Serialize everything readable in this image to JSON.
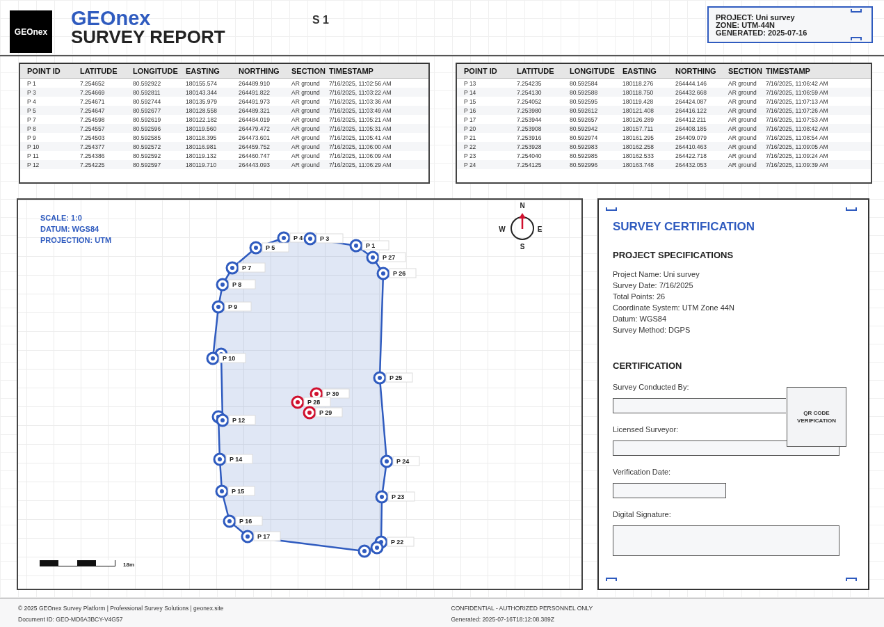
{
  "header": {
    "logo": "GEOnex",
    "brand": "GEOnex",
    "title": "SURVEY REPORT",
    "sheet": "S 1",
    "info": [
      "PROJECT: Uni survey",
      "ZONE: UTM-44N",
      "GENERATED: 2025-07-16"
    ]
  },
  "tables": [
    {
      "columns": [
        "POINT ID",
        "LATITUDE",
        "LONGITUDE",
        "EASTING",
        "NORTHING",
        "SECTION",
        "TIMESTAMP"
      ],
      "rows": [
        [
          "P 1",
          "7.254652",
          "80.592922",
          "180155.574",
          "264489.910",
          "AR ground",
          "7/16/2025, 11:02:56 AM"
        ],
        [
          "P 3",
          "7.254669",
          "80.592811",
          "180143.344",
          "264491.822",
          "AR ground",
          "7/16/2025, 11:03:22 AM"
        ],
        [
          "P 4",
          "7.254671",
          "80.592744",
          "180135.979",
          "264491.973",
          "AR ground",
          "7/16/2025, 11:03:36 AM"
        ],
        [
          "P 5",
          "7.254647",
          "80.592677",
          "180128.558",
          "264489.321",
          "AR ground",
          "7/16/2025, 11:03:49 AM"
        ],
        [
          "P 7",
          "7.254598",
          "80.592619",
          "180122.182",
          "264484.019",
          "AR ground",
          "7/16/2025, 11:05:21 AM"
        ],
        [
          "P 8",
          "7.254557",
          "80.592596",
          "180119.560",
          "264479.472",
          "AR ground",
          "7/16/2025, 11:05:31 AM"
        ],
        [
          "P 9",
          "7.254503",
          "80.592585",
          "180118.395",
          "264473.601",
          "AR ground",
          "7/16/2025, 11:05:41 AM"
        ],
        [
          "P 10",
          "7.254377",
          "80.592572",
          "180116.981",
          "264459.752",
          "AR ground",
          "7/16/2025, 11:06:00 AM"
        ],
        [
          "P 11",
          "7.254386",
          "80.592592",
          "180119.132",
          "264460.747",
          "AR ground",
          "7/16/2025, 11:06:09 AM"
        ],
        [
          "P 12",
          "7.254225",
          "80.592597",
          "180119.710",
          "264443.093",
          "AR ground",
          "7/16/2025, 11:06:29 AM"
        ]
      ]
    },
    {
      "columns": [
        "POINT ID",
        "LATITUDE",
        "LONGITUDE",
        "EASTING",
        "NORTHING",
        "SECTION",
        "TIMESTAMP"
      ],
      "rows": [
        [
          "P 13",
          "7.254235",
          "80.592584",
          "180118.276",
          "264444.146",
          "AR ground",
          "7/16/2025, 11:06:42 AM"
        ],
        [
          "P 14",
          "7.254130",
          "80.592588",
          "180118.750",
          "264432.668",
          "AR ground",
          "7/16/2025, 11:06:59 AM"
        ],
        [
          "P 15",
          "7.254052",
          "80.592595",
          "180119.428",
          "264424.087",
          "AR ground",
          "7/16/2025, 11:07:13 AM"
        ],
        [
          "P 16",
          "7.253980",
          "80.592612",
          "180121.408",
          "264416.122",
          "AR ground",
          "7/16/2025, 11:07:26 AM"
        ],
        [
          "P 17",
          "7.253944",
          "80.592657",
          "180126.289",
          "264412.211",
          "AR ground",
          "7/16/2025, 11:07:53 AM"
        ],
        [
          "P 20",
          "7.253908",
          "80.592942",
          "180157.711",
          "264408.185",
          "AR ground",
          "7/16/2025, 11:08:42 AM"
        ],
        [
          "P 21",
          "7.253916",
          "80.592974",
          "180161.295",
          "264409.079",
          "AR ground",
          "7/16/2025, 11:08:54 AM"
        ],
        [
          "P 22",
          "7.253928",
          "80.592983",
          "180162.258",
          "264410.463",
          "AR ground",
          "7/16/2025, 11:09:05 AM"
        ],
        [
          "P 23",
          "7.254040",
          "80.592985",
          "180162.533",
          "264422.718",
          "AR ground",
          "7/16/2025, 11:09:24 AM"
        ],
        [
          "P 24",
          "7.254125",
          "80.592996",
          "180163.748",
          "264432.053",
          "AR ground",
          "7/16/2025, 11:09:39 AM"
        ]
      ]
    }
  ],
  "map": {
    "legend": [
      "SCALE: 1:0",
      "DATUM: WGS84",
      "PROJECTION: UTM"
    ],
    "compass": {
      "north": "N",
      "east": "E",
      "south": "S",
      "west": "W"
    },
    "scale_label": "18m",
    "points": [
      {
        "label": "P 4",
        "kind": "boundary"
      },
      {
        "label": "P 3",
        "kind": "boundary"
      },
      {
        "label": "P 1",
        "kind": "boundary"
      },
      {
        "label": "P 5",
        "kind": "boundary"
      },
      {
        "label": "P 27",
        "kind": "boundary"
      },
      {
        "label": "P 7",
        "kind": "boundary"
      },
      {
        "label": "P 26",
        "kind": "boundary"
      },
      {
        "label": "P 8",
        "kind": "boundary"
      },
      {
        "label": "P 9",
        "kind": "boundary"
      },
      {
        "kind": "boundary"
      },
      {
        "label": "P 10",
        "kind": "boundary"
      },
      {
        "label": "P 25",
        "kind": "boundary"
      },
      {
        "label": "P 30",
        "kind": "marker"
      },
      {
        "label": "P 28",
        "kind": "marker"
      },
      {
        "label": "P 29",
        "kind": "marker"
      },
      {
        "kind": "boundary"
      },
      {
        "label": "P 12",
        "kind": "boundary"
      },
      {
        "label": "P 14",
        "kind": "boundary"
      },
      {
        "label": "P 24",
        "kind": "boundary"
      },
      {
        "label": "P 15",
        "kind": "boundary"
      },
      {
        "label": "P 23",
        "kind": "boundary"
      },
      {
        "label": "P 16",
        "kind": "boundary"
      },
      {
        "label": "P 17",
        "kind": "boundary"
      },
      {
        "label": "P 22",
        "kind": "boundary"
      },
      {
        "kind": "boundary"
      },
      {
        "kind": "boundary"
      }
    ]
  },
  "certification": {
    "title": "SURVEY CERTIFICATION",
    "specs_heading": "PROJECT SPECIFICATIONS",
    "specs": [
      "Project Name: Uni survey",
      "Survey Date: 7/16/2025",
      "Total Points: 26",
      "Coordinate System: UTM Zone 44N",
      "Datum: WGS84",
      "Survey Method: DGPS"
    ],
    "cert_heading": "CERTIFICATION",
    "fields": [
      {
        "label": "Survey Conducted By:",
        "kind": "long"
      },
      {
        "label": "Licensed Surveyor:",
        "kind": "long"
      },
      {
        "label": "Verification Date:",
        "kind": "short"
      },
      {
        "label": "Digital Signature:",
        "kind": "tall"
      }
    ],
    "qr": "QR CODE VERIFICATION"
  },
  "footer": {
    "left": [
      "© 2025 GEOnex Survey Platform | Professional Survey Solutions | geonex.site",
      "Document ID: GEO-MD6A3BCY-V4G57"
    ],
    "right": [
      "CONFIDENTIAL - AUTHORIZED PERSONNEL ONLY",
      "Generated: 2025-07-16T18:12:08.389Z"
    ]
  }
}
